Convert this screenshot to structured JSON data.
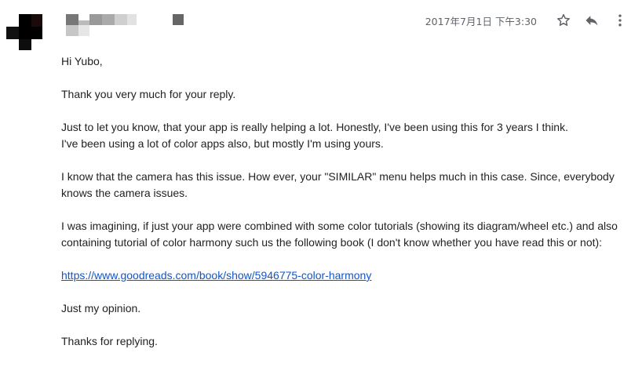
{
  "header": {
    "timestamp": "2017年7月1日 下午3:30",
    "icons": {
      "star": "star-icon",
      "reply": "reply-icon",
      "more": "more-vert-icon"
    },
    "colors": {
      "icon": "#5f6368",
      "link": "#1155cc",
      "text": "#222222"
    }
  },
  "body": {
    "greeting": "Hi Yubo,",
    "thanks_reply": "Thank you very much for your reply.",
    "p2_line1": "Just to let you know, that your app is really helping a lot. Honestly, I've been using this for 3 years I think.",
    "p2_line2": "I've been using a lot of color apps also, but mostly I'm using yours.",
    "p3": "I know that the camera has this issue. How ever, your \"SIMILAR\" menu helps much in this case. Since, everybody knows the camera issues.",
    "p4": "I was imagining, if just your app were combined with some color tutorials (showing its diagram/wheel etc.) and also containing tutorial of color harmony such us the following book (I don't know whether you have read this or not):",
    "link": "https://www.goodreads.com/book/show/5946775-color-harmony",
    "opinion": "Just my opinion.",
    "closing": "Thanks for replying."
  }
}
